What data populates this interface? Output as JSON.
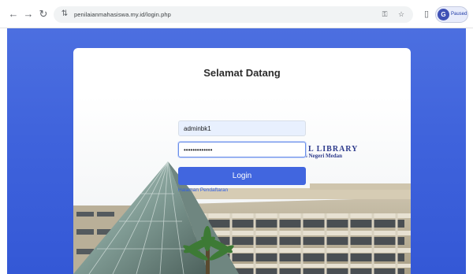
{
  "browser": {
    "url": "penilaianmahasiswa.my.id/login.php",
    "profile_label": "Paused",
    "profile_initial": "G"
  },
  "page": {
    "title": "Selamat Datang",
    "username_value": "adminbk1",
    "password_value": "•••••••••••••",
    "login_label": "Login",
    "register_link": "Halaman Pendaftaran",
    "building_sign_line1": "L LIBRARY",
    "building_sign_line2": "s Negeri Medan"
  },
  "colors": {
    "page_background": "#3f63dc",
    "button": "#4166df"
  }
}
